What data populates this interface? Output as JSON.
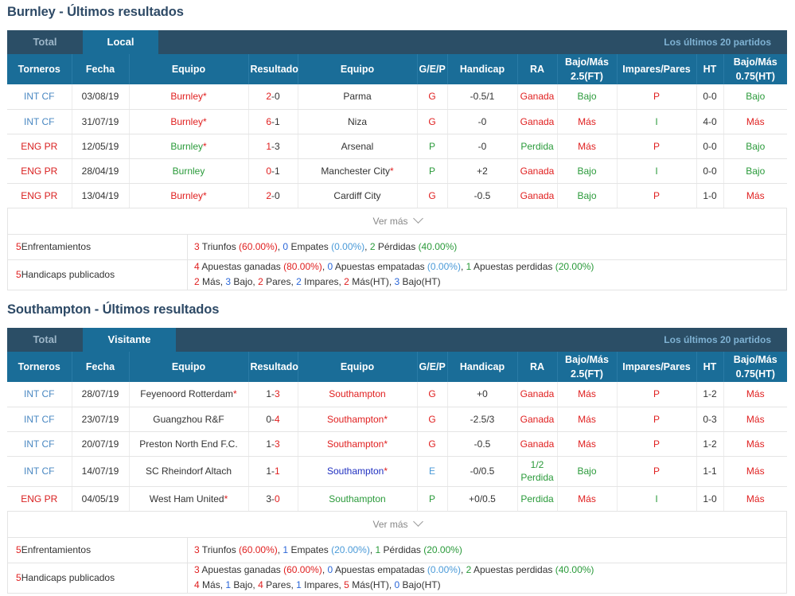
{
  "sections": [
    {
      "title": "Burnley - Últimos resultados",
      "tabs": {
        "total": "Total",
        "active": "Local",
        "right": "Los últimos 20 partidos"
      },
      "headers": [
        "Torneros",
        "Fecha",
        "Equipo",
        "Resultado",
        "Equipo",
        "G/E/P",
        "Handicap",
        "RA",
        "Bajo/Más 2.5(FT)",
        "Impares/Pares",
        "HT",
        "Bajo/Más 0.75(HT)"
      ],
      "rows": [
        {
          "comp": "INT CF",
          "date": "03/08/19",
          "home": "Burnley",
          "home_star": "*",
          "res_h": "2",
          "res_a": "0",
          "away": "Parma",
          "away_star": "",
          "gep": "G",
          "hcp": "-0.5/1",
          "ra": "Ganada",
          "bm": "Bajo",
          "ip": "P",
          "ht": "0-0",
          "bm2": "Bajo"
        },
        {
          "comp": "INT CF",
          "date": "31/07/19",
          "home": "Burnley",
          "home_star": "*",
          "res_h": "6",
          "res_a": "1",
          "away": "Niza",
          "away_star": "",
          "gep": "G",
          "hcp": "-0",
          "ra": "Ganada",
          "bm": "Más",
          "ip": "I",
          "ht": "4-0",
          "bm2": "Más"
        },
        {
          "comp": "ENG PR",
          "date": "12/05/19",
          "home": "Burnley",
          "home_star": "*",
          "res_h": "1",
          "res_a": "3",
          "away": "Arsenal",
          "away_star": "",
          "gep": "P",
          "hcp": "-0",
          "ra": "Perdida",
          "bm": "Más",
          "ip": "P",
          "ht": "0-0",
          "bm2": "Bajo"
        },
        {
          "comp": "ENG PR",
          "date": "28/04/19",
          "home": "Burnley",
          "home_star": "",
          "res_h": "0",
          "res_a": "1",
          "away": "Manchester City",
          "away_star": "*",
          "gep": "P",
          "hcp": "+2",
          "ra": "Ganada",
          "bm": "Bajo",
          "ip": "I",
          "ht": "0-0",
          "bm2": "Bajo"
        },
        {
          "comp": "ENG PR",
          "date": "13/04/19",
          "home": "Burnley",
          "home_star": "*",
          "res_h": "2",
          "res_a": "0",
          "away": "Cardiff City",
          "away_star": "",
          "gep": "G",
          "hcp": "-0.5",
          "ra": "Ganada",
          "bm": "Bajo",
          "ip": "P",
          "ht": "1-0",
          "bm2": "Más"
        }
      ],
      "ver_mas": "Ver más",
      "summary": {
        "enf_label_num": "5",
        "enf_label": " Enfrentamientos",
        "enf": {
          "w": "3",
          "w_t": " Triunfos ",
          "w_p": "(60.00%)",
          "d": "0",
          "d_t": " Empates ",
          "d_p": "(0.00%)",
          "l": "2",
          "l_t": " Pérdidas ",
          "l_p": "(40.00%)"
        },
        "hcp_label_num": "5",
        "hcp_label": " Handicaps publicados",
        "hcp": {
          "w": "4",
          "w_t": " Apuestas ganadas ",
          "w_p": "(80.00%)",
          "d": "0",
          "d_t": " Apuestas empatadas ",
          "d_p": "(0.00%)",
          "l": "1",
          "l_t": " Apuestas perdidas ",
          "l_p": "(20.00%)"
        },
        "line2": [
          {
            "n": "2",
            "t": " Más, "
          },
          {
            "n": "3",
            "t": " Bajo, "
          },
          {
            "n": "2",
            "t": " Pares, "
          },
          {
            "n": "2",
            "t": " Impares, "
          },
          {
            "n": "2",
            "t": " Más(HT), "
          },
          {
            "n": "3",
            "t": " Bajo(HT)"
          }
        ]
      }
    },
    {
      "title": "Southampton - Últimos resultados",
      "tabs": {
        "total": "Total",
        "active": "Visitante",
        "right": "Los últimos 20 partidos"
      },
      "headers": [
        "Torneros",
        "Fecha",
        "Equipo",
        "Resultado",
        "Equipo",
        "G/E/P",
        "Handicap",
        "RA",
        "Bajo/Más 2.5(FT)",
        "Impares/Pares",
        "HT",
        "Bajo/Más 0.75(HT)"
      ],
      "rows": [
        {
          "comp": "INT CF",
          "date": "28/07/19",
          "home": "Feyenoord Rotterdam",
          "home_star": "*",
          "res_h": "1",
          "res_a": "3",
          "away": "Southampton",
          "away_star": "",
          "gep": "G",
          "hcp": "+0",
          "ra": "Ganada",
          "bm": "Más",
          "ip": "P",
          "ht": "1-2",
          "bm2": "Más"
        },
        {
          "comp": "INT CF",
          "date": "23/07/19",
          "home": "Guangzhou R&F",
          "home_star": "",
          "res_h": "0",
          "res_a": "4",
          "away": "Southampton",
          "away_star": "*",
          "gep": "G",
          "hcp": "-2.5/3",
          "ra": "Ganada",
          "bm": "Más",
          "ip": "P",
          "ht": "0-3",
          "bm2": "Más"
        },
        {
          "comp": "INT CF",
          "date": "20/07/19",
          "home": "Preston North End F.C.",
          "home_star": "",
          "res_h": "1",
          "res_a": "3",
          "away": "Southampton",
          "away_star": "*",
          "gep": "G",
          "hcp": "-0.5",
          "ra": "Ganada",
          "bm": "Más",
          "ip": "P",
          "ht": "1-2",
          "bm2": "Más"
        },
        {
          "comp": "INT CF",
          "date": "14/07/19",
          "home": "SC Rheindorf Altach",
          "home_star": "",
          "res_h": "1",
          "res_a": "1",
          "away": "Southampton",
          "away_star": "*",
          "gep": "E",
          "hcp": "-0/0.5",
          "ra": "1/2 Perdida",
          "bm": "Bajo",
          "ip": "P",
          "ht": "1-1",
          "bm2": "Más"
        },
        {
          "comp": "ENG PR",
          "date": "04/05/19",
          "home": "West Ham United",
          "home_star": "*",
          "res_h": "3",
          "res_a": "0",
          "away": "Southampton",
          "away_star": "",
          "gep": "P",
          "hcp": "+0/0.5",
          "ra": "Perdida",
          "bm": "Más",
          "ip": "I",
          "ht": "1-0",
          "bm2": "Más"
        }
      ],
      "ver_mas": "Ver más",
      "summary": {
        "enf_label_num": "5",
        "enf_label": " Enfrentamientos",
        "enf": {
          "w": "3",
          "w_t": " Triunfos ",
          "w_p": "(60.00%)",
          "d": "1",
          "d_t": " Empates ",
          "d_p": "(20.00%)",
          "l": "1",
          "l_t": " Pérdidas ",
          "l_p": "(20.00%)"
        },
        "hcp_label_num": "5",
        "hcp_label": " Handicaps publicados",
        "hcp": {
          "w": "3",
          "w_t": " Apuestas ganadas ",
          "w_p": "(60.00%)",
          "d": "0",
          "d_t": " Apuestas empatadas ",
          "d_p": "(0.00%)",
          "l": "2",
          "l_t": " Apuestas perdidas ",
          "l_p": "(40.00%)"
        },
        "line2": [
          {
            "n": "4",
            "t": " Más, "
          },
          {
            "n": "1",
            "t": " Bajo, "
          },
          {
            "n": "4",
            "t": " Pares, "
          },
          {
            "n": "1",
            "t": " Impares, "
          },
          {
            "n": "5",
            "t": " Más(HT), "
          },
          {
            "n": "0",
            "t": " Bajo(HT)"
          }
        ]
      }
    }
  ]
}
